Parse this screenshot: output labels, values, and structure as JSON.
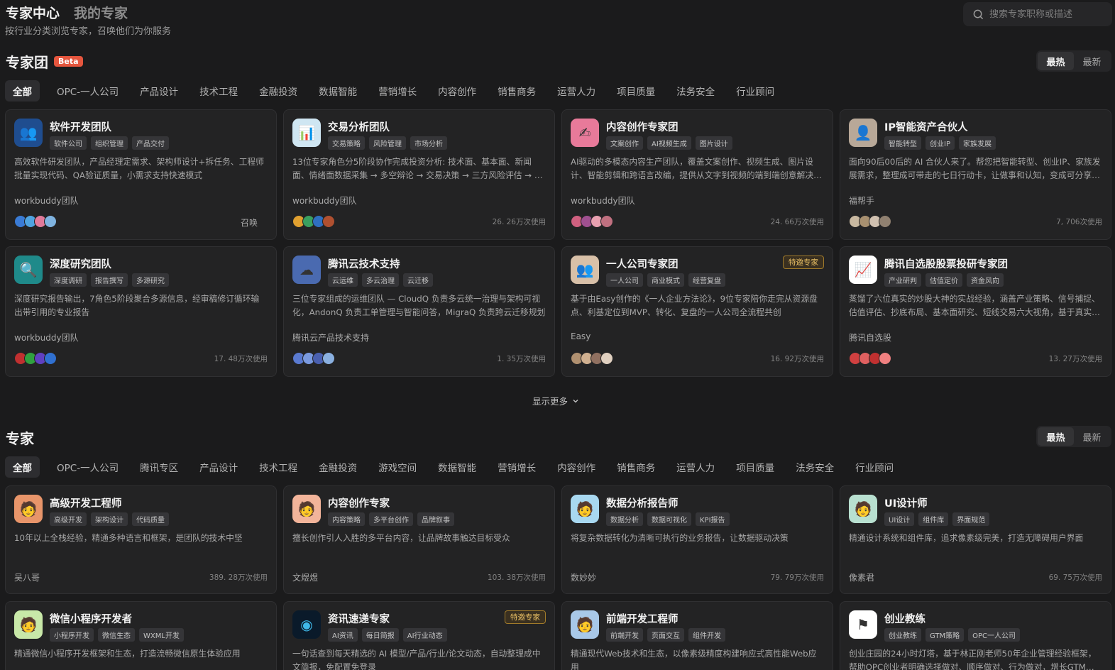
{
  "header": {
    "tabs": [
      "专家中心",
      "我的专家"
    ],
    "subtitle": "按行业分类浏览专家，召唤他们为你服务",
    "search_placeholder": "搜索专家职称或描述"
  },
  "teams": {
    "title": "专家团",
    "badge": "Beta",
    "sort": [
      "最热",
      "最新"
    ],
    "categories": [
      "全部",
      "OPC-一人公司",
      "产品设计",
      "技术工程",
      "金融投资",
      "数据智能",
      "营销增长",
      "内容创作",
      "销售商务",
      "运营人力",
      "项目质量",
      "法务安全",
      "行业顾问"
    ],
    "cards": [
      {
        "title": "软件开发团队",
        "tags": [
          "软件公司",
          "组织管理",
          "产品交付"
        ],
        "desc": "高效软件研发团队，产品经理定需求、架构师设计+拆任务、工程师批量实现代码、QA验证质量，小需求支持快速模式",
        "author": "workbuddy团队",
        "usage": "",
        "action": "召唤",
        "special": "",
        "icon": "team-icon",
        "color": "#1f4d8f",
        "members": [
          "#3a7bd5",
          "#4fa3e0",
          "#e07a9a",
          "#7fb3e0"
        ]
      },
      {
        "title": "交易分析团队",
        "tags": [
          "交易策略",
          "风险管理",
          "市场分析"
        ],
        "desc": "13位专家角色分5阶段协作完成投资分析: 技术面、基本面、新闻面、情绪面数据采集 → 多空辩论 → 交易决策 → 三方风险评估 → 组合经理终审",
        "author": "workbuddy团队",
        "usage": "26. 26万次使用",
        "action": "",
        "special": "",
        "icon": "chart-icon",
        "color": "#cfe6f2",
        "members": [
          "#e0a030",
          "#3aa060",
          "#2f6fc0",
          "#b05030"
        ]
      },
      {
        "title": "内容创作专家团",
        "tags": [
          "文案创作",
          "AI视频生成",
          "图片设计"
        ],
        "desc": "AI驱动的多模态内容生产团队，覆盖文案创作、视频生成、图片设计、智能剪辑和跨语言改编，提供从文字到视频的端到端创意解决方案",
        "author": "workbuddy团队",
        "usage": "24. 66万次使用",
        "action": "",
        "special": "",
        "icon": "pen-icon",
        "color": "#e87a9a",
        "members": [
          "#d06080",
          "#a05090",
          "#e8a0b0",
          "#c07080"
        ]
      },
      {
        "title": "IP智能资产合伙人",
        "tags": [
          "智能转型",
          "创业IP",
          "家族发展"
        ],
        "desc": "面向90后00后的 AI 合伙人来了。帮您把智能转型、创业IP、家族发展需求，整理成可带走的七日行动卡，让做事和认知，变成可分享的资产",
        "author": "福帮手",
        "usage": "7, 706次使用",
        "action": "",
        "special": "",
        "icon": "person-icon",
        "color": "#b8a898",
        "members": [
          "#c8b8a0",
          "#a89070",
          "#d0c0b0",
          "#908070"
        ]
      },
      {
        "title": "深度研究团队",
        "tags": [
          "深度调研",
          "报告撰写",
          "多源研究"
        ],
        "desc": "深度研究报告输出，7角色5阶段聚合多源信息，经审稿修订循环输出带引用的专业报告",
        "author": "workbuddy团队",
        "usage": "17. 48万次使用",
        "action": "",
        "special": "",
        "icon": "search-icon",
        "color": "#1f8a8a",
        "members": [
          "#c03030",
          "#30a040",
          "#6040c0",
          "#3070d0"
        ]
      },
      {
        "title": "腾讯云技术支持",
        "tags": [
          "云运维",
          "多云治理",
          "云迁移"
        ],
        "desc": "三位专家组成的运维团队 — CloudQ 负责多云统一治理与架构可视化，AndonQ 负责工单管理与智能问答，MigraQ 负责跨云迁移规划",
        "author": "腾讯云产品技术支持",
        "usage": "1. 35万次使用",
        "action": "",
        "special": "",
        "icon": "cloud-icon",
        "color": "#4a6ab0",
        "members": [
          "#5a7ad0",
          "#7a9ae0",
          "#4a60b0",
          "#8ab0e0"
        ]
      },
      {
        "title": "一人公司专家团",
        "tags": [
          "一人公司",
          "商业模式",
          "经营复盘"
        ],
        "desc": "基于由Easy创作的《一人企业方法论》，9位专家陪你走完从资源盘点、利基定位到MVP、转化、复盘的一人公司全流程共创",
        "author": "Easy",
        "usage": "16. 92万次使用",
        "action": "",
        "special": "特邀专家",
        "icon": "users-icon",
        "color": "#d8c0a8",
        "members": [
          "#b09070",
          "#d0b090",
          "#907060",
          "#e0d0c0"
        ]
      },
      {
        "title": "腾讯自选股股票投研专家团",
        "tags": [
          "产业研判",
          "估值定价",
          "资金风向"
        ],
        "desc": "蒸馏了六位真实的炒股大神的实战经验，涵盖产业策略、信号捕捉、估值评估、抄底布局、基本面研究、短线交易六大视角，基于真实数据提供专业分析",
        "author": "腾讯自选股",
        "usage": "13. 27万次使用",
        "action": "",
        "special": "",
        "icon": "stock-icon",
        "color": "#ffffff",
        "members": [
          "#d04040",
          "#e06060",
          "#c03030",
          "#f08080"
        ]
      }
    ],
    "show_more": "显示更多"
  },
  "experts": {
    "title": "专家",
    "sort": [
      "最热",
      "最新"
    ],
    "categories": [
      "全部",
      "OPC-一人公司",
      "腾讯专区",
      "产品设计",
      "技术工程",
      "金融投资",
      "游戏空间",
      "数据智能",
      "营销增长",
      "内容创作",
      "销售商务",
      "运营人力",
      "项目质量",
      "法务安全",
      "行业顾问"
    ],
    "cards": [
      {
        "title": "高级开发工程师",
        "tags": [
          "高级开发",
          "架构设计",
          "代码质量"
        ],
        "desc": "10年以上全栈经验，精通多种语言和框架，是团队的技术中坚",
        "author": "吴八哥",
        "usage": "389. 28万次使用",
        "special": "",
        "icon": "developer-avatar-icon",
        "color": "#e8956a"
      },
      {
        "title": "内容创作专家",
        "tags": [
          "内容策略",
          "多平台创作",
          "品牌叙事"
        ],
        "desc": "擅长创作引人入胜的多平台内容，让品牌故事触达目标受众",
        "author": "文煜煜",
        "usage": "103. 38万次使用",
        "special": "",
        "icon": "writer-avatar-icon",
        "color": "#f2b49a"
      },
      {
        "title": "数据分析报告师",
        "tags": [
          "数据分析",
          "数据可视化",
          "KPI报告"
        ],
        "desc": "将复杂数据转化为清晰可执行的业务报告，让数据驱动决策",
        "author": "数妙妙",
        "usage": "79. 79万次使用",
        "special": "",
        "icon": "analyst-avatar-icon",
        "color": "#a8d8f0"
      },
      {
        "title": "UI设计师",
        "tags": [
          "UI设计",
          "组件库",
          "界面规范"
        ],
        "desc": "精通设计系统和组件库，追求像素级完美，打造无障碍用户界面",
        "author": "像素君",
        "usage": "69. 75万次使用",
        "special": "",
        "icon": "designer-avatar-icon",
        "color": "#b8e0d0"
      },
      {
        "title": "微信小程序开发者",
        "tags": [
          "小程序开发",
          "微信生态",
          "WXML开发"
        ],
        "desc": "精通微信小程序开发框架和生态，打造流畅微信原生体验应用",
        "author": "",
        "usage": "",
        "special": "",
        "icon": "miniapp-avatar-icon",
        "color": "#c8e8a8"
      },
      {
        "title": "资讯速递专家",
        "tags": [
          "AI资讯",
          "每日简报",
          "AI行业动态"
        ],
        "desc": "一句话查到每天精选的 AI 模型/产品/行业/论文动态，自动整理成中文简报，免配置免登录",
        "author": "",
        "usage": "",
        "special": "特邀专家",
        "icon": "news-icon",
        "color": "#0a1a2a"
      },
      {
        "title": "前端开发工程师",
        "tags": [
          "前端开发",
          "页面交互",
          "组件开发"
        ],
        "desc": "精通现代Web技术和生态，以像素级精度构建响应式高性能Web应用",
        "author": "",
        "usage": "",
        "special": "",
        "icon": "frontend-avatar-icon",
        "color": "#a8c8e8"
      },
      {
        "title": "创业教练",
        "tags": [
          "创业教练",
          "GTM策略",
          "OPC一人公司"
        ],
        "desc": "创业庄园的24小时灯塔，基于林正刚老师50年企业管理经验框架，帮助OPC创业者明确选择做对、顺序做对、行为做对，增长GTM策略",
        "author": "",
        "usage": "",
        "special": "",
        "icon": "coach-icon",
        "color": "#ffffff"
      }
    ]
  }
}
